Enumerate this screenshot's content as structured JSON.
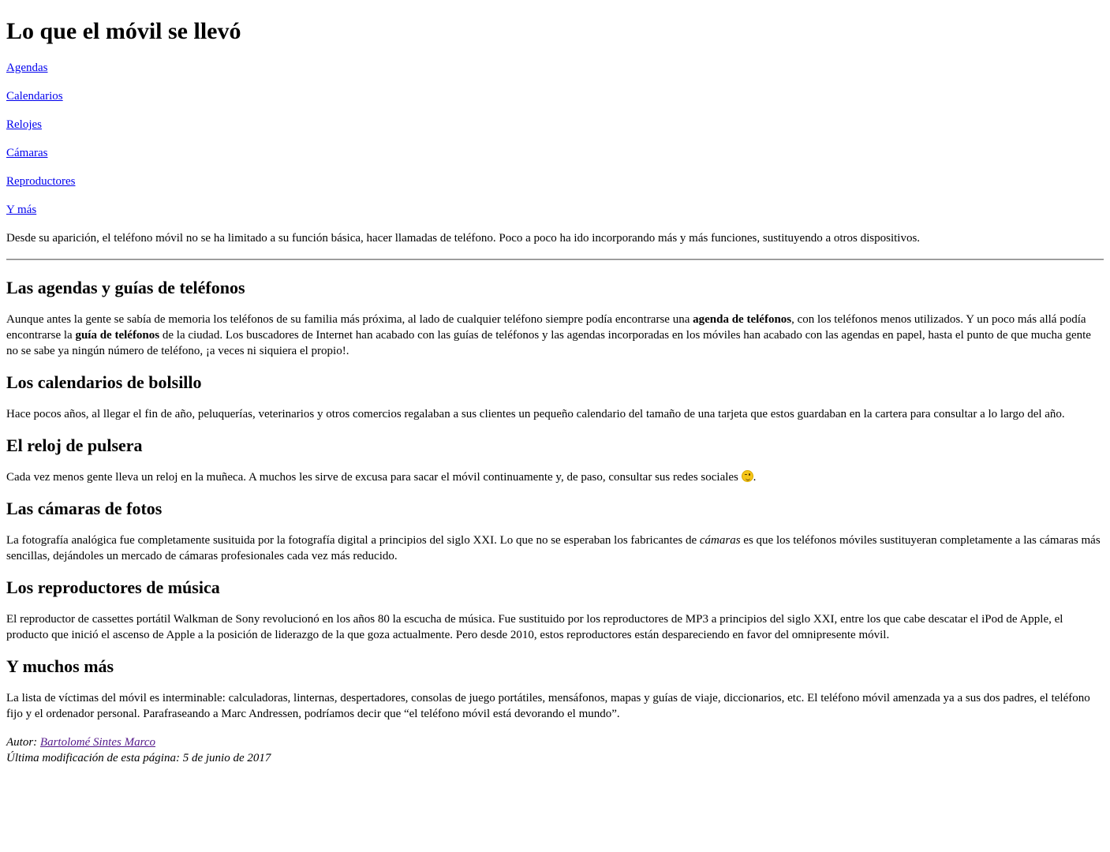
{
  "title": "Lo que el móvil se llevó",
  "nav": [
    {
      "label": "Agendas"
    },
    {
      "label": "Calendarios"
    },
    {
      "label": "Relojes"
    },
    {
      "label": "Cámaras"
    },
    {
      "label": "Reproductores"
    },
    {
      "label": "Y más"
    }
  ],
  "intro": "Desde su aparición, el teléfono móvil no se ha limitado a su función básica, hacer llamadas de teléfono. Poco a poco ha ido incorporando más y más funciones, sustituyendo a otros dispositivos.",
  "sections": {
    "agendas": {
      "heading": "Las agendas y guías de teléfonos",
      "t1": "Aunque antes la gente se sabía de memoria los teléfonos de su familia más próxima, al lado de cualquier teléfono siempre podía encontrarse una ",
      "b1": "agenda de teléfonos",
      "t2": ", con los teléfonos menos utilizados. Y un poco más allá podía encontrarse la ",
      "b2": "guía de teléfonos",
      "t3": " de la ciudad. Los buscadores de Internet han acabado con las guías de teléfonos y las agendas incorporadas en los móviles han acabado con las agendas en papel, hasta el punto de que mucha gente no se sabe ya ningún número de teléfono, ¡a veces ni siquiera el propio!."
    },
    "calendarios": {
      "heading": "Los calendarios de bolsillo",
      "text": "Hace pocos años, al llegar el fin de año, peluquerías, veterinarios y otros comercios regalaban a sus clientes un pequeño calendario del tamaño de una tarjeta que estos guardaban en la cartera para consultar a lo largo del año."
    },
    "relojes": {
      "heading": "El reloj de pulsera",
      "text": "Cada vez menos gente lleva un reloj en la muñeca. A muchos les sirve de excusa para sacar el móvil continuamente y, de paso, consultar sus redes sociales ",
      "emoji": "wink-emoji-icon",
      "after": "."
    },
    "camaras": {
      "heading": "Las cámaras de fotos",
      "t1": "La fotografía analógica fue completamente susituida por la fotografía digital a principios del siglo XXI. Lo que no se esperaban los fabricantes de ",
      "em": "cámaras",
      "t2": " es que los teléfonos móviles sustituyeran completamente a las cámaras más sencillas, dejándoles un mercado de cámaras profesionales cada vez más reducido."
    },
    "reproductores": {
      "heading": "Los reproductores de música",
      "text": "El reproductor de cassettes portátil Walkman de Sony revolucionó en los años 80 la escucha de música. Fue sustituido por los reproductores de MP3 a principios del siglo XXI, entre los que cabe descatar el iPod de Apple, el producto que inició el ascenso de Apple a la posición de liderazgo de la que goza actualmente. Pero desde 2010, estos reproductores están despareciendo en favor del omnipresente móvil."
    },
    "mas": {
      "heading": "Y muchos más",
      "text": "La lista de víctimas del móvil es interminable: calculadoras, linternas, despertadores, consolas de juego portátiles, mensáfonos, mapas y guías de viaje, diccionarios, etc. El teléfono móvil amenzada ya a sus dos padres, el teléfono fijo y el ordenador personal. Parafraseando a Marc Andressen, podríamos decir que “el teléfono móvil está devorando el mundo”."
    }
  },
  "footer": {
    "author_prefix": "Autor: ",
    "author_name": "Bartolomé Sintes Marco",
    "modified": "Última modificación de esta página: 5 de junio de 2017"
  }
}
